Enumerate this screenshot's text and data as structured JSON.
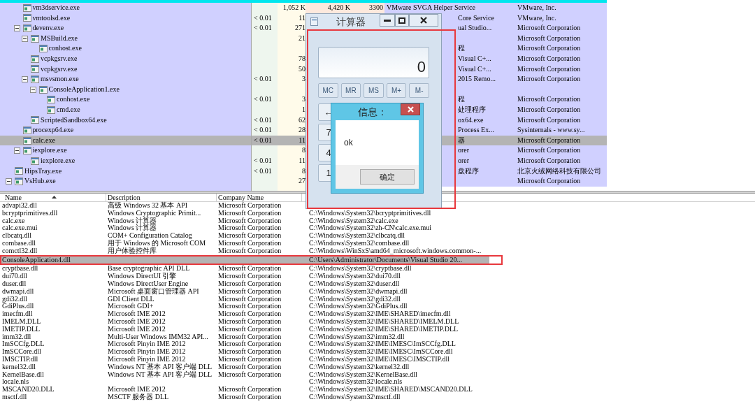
{
  "process_tree": [
    {
      "children": [
        {
          "name": "vm3dservice.exe",
          "private_bytes": "1,052 K",
          "working_set": "4,420 K",
          "pid": "3300",
          "description": "VMware SVGA Helper Service",
          "company": "VMware, Inc.",
          "selected": false
        },
        {
          "name": "vmtoolsd.exe",
          "cpu": "< 0.01",
          "private_bytes": "11",
          "description_cut": "Core Service",
          "company": "VMware, Inc.",
          "selected": false
        },
        {
          "name": "devenv.exe",
          "cpu": "< 0.01",
          "private_bytes": "271",
          "description_cut": "ual Studio...",
          "company": "Microsoft Corporation",
          "selected": false,
          "expanded": true,
          "children": [
            {
              "name": "MSBuild.exe",
              "private_bytes": "21",
              "company": "Microsoft Corporation",
              "selected": false,
              "expanded": true,
              "children": [
                {
                  "name": "conhost.exe",
                  "description_cut": "程",
                  "company": "Microsoft Corporation",
                  "selected": false
                }
              ]
            },
            {
              "name": "vcpkgsrv.exe",
              "private_bytes": "78",
              "description_cut": "Visual C+...",
              "company": "Microsoft Corporation",
              "selected": false
            },
            {
              "name": "vcpkgsrv.exe",
              "private_bytes": "50",
              "description_cut": "Visual C+...",
              "company": "Microsoft Corporation",
              "selected": false
            },
            {
              "name": "msvsmon.exe",
              "cpu": "< 0.01",
              "private_bytes": "3",
              "description_cut": "2015 Remo...",
              "company": "Microsoft Corporation",
              "selected": false,
              "expanded": true,
              "children": [
                {
                  "name": "ConsoleApplication1.exe",
                  "selected": false,
                  "expanded": true,
                  "children": [
                    {
                      "name": "conhost.exe",
                      "cpu": "< 0.01",
                      "private_bytes": "3",
                      "description_cut": "程",
                      "company": "Microsoft Corporation",
                      "selected": false
                    },
                    {
                      "name": "cmd.exe",
                      "private_bytes": "1",
                      "description_cut": "处理程序",
                      "company": "Microsoft Corporation",
                      "selected": false
                    }
                  ]
                }
              ]
            },
            {
              "name": "ScriptedSandbox64.exe",
              "cpu": "< 0.01",
              "private_bytes": "62",
              "description_cut": "ox64.exe",
              "company": "Microsoft Corporation",
              "selected": false
            }
          ]
        },
        {
          "name": "procexp64.exe",
          "cpu": "< 0.01",
          "private_bytes": "28",
          "description_cut": "Process Ex...",
          "company": "Sysinternals - www.sy...",
          "selected": false
        },
        {
          "name": "calc.exe",
          "cpu": "< 0.01",
          "private_bytes": "11",
          "description_cut": "器",
          "company": "Microsoft Corporation",
          "selected": true
        },
        {
          "name": "iexplore.exe",
          "private_bytes": "8",
          "description_cut": "orer",
          "company": "Microsoft Corporation",
          "selected": false,
          "expanded": true,
          "children": [
            {
              "name": "iexplore.exe",
              "cpu": "< 0.01",
              "private_bytes": "11",
              "description_cut": "orer",
              "company": "Microsoft Corporation",
              "selected": false
            }
          ]
        }
      ]
    },
    {
      "name": "HipsTray.exe",
      "cpu": "< 0.01",
      "private_bytes": "8",
      "description_cut": "盘程序",
      "company": "北京火绒网络科技有限公司",
      "selected": false
    },
    {
      "name": "VsHub.exe",
      "private_bytes": "27",
      "company": "Microsoft Corporation",
      "selected": false,
      "expanded": true
    }
  ],
  "dll_table": {
    "columns": [
      "Name",
      "Description",
      "Company Name"
    ],
    "sort_ascending": true,
    "rows": [
      {
        "name": "advapi32.dll",
        "description": "高级 Windows 32 基本 API",
        "company": "Microsoft Corporation",
        "selected": false
      },
      {
        "name": "bcryptprimitives.dll",
        "description": "Windows Cryptographic Primit...",
        "company": "Microsoft Corporation",
        "path": "C:\\Windows\\System32\\bcryptprimitives.dll",
        "selected": false
      },
      {
        "name": "calc.exe",
        "description": "Windows 计算器",
        "company": "Microsoft Corporation",
        "path": "C:\\Windows\\System32\\calc.exe",
        "selected": false
      },
      {
        "name": "calc.exe.mui",
        "description": "Windows 计算器",
        "company": "Microsoft Corporation",
        "path": "C:\\Windows\\System32\\zh-CN\\calc.exe.mui",
        "selected": false
      },
      {
        "name": "clbcatq.dll",
        "description": "COM+ Configuration Catalog",
        "company": "Microsoft Corporation",
        "path": "C:\\Windows\\System32\\clbcatq.dll",
        "selected": false
      },
      {
        "name": "combase.dll",
        "description": "用于 Windows 的 Microsoft COM",
        "company": "Microsoft Corporation",
        "path": "C:\\Windows\\System32\\combase.dll",
        "selected": false
      },
      {
        "name": "comctl32.dll",
        "description": "用户体验控件库",
        "company": "Microsoft Corporation",
        "path": "C:\\Windows\\WinSxS\\amd64_microsoft.windows.common-...",
        "selected": false
      },
      {
        "name": "ConsoleApplication4.dll",
        "path": "C:\\Users\\Administrator\\Documents\\Visual Studio 20...",
        "selected": true
      },
      {
        "name": "cryptbase.dll",
        "description": "Base cryptographic API DLL",
        "company": "Microsoft Corporation",
        "path": "C:\\Windows\\System32\\cryptbase.dll",
        "selected": false
      },
      {
        "name": "dui70.dll",
        "description": "Windows DirectUI 引擎",
        "company": "Microsoft Corporation",
        "path": "C:\\Windows\\System32\\dui70.dll",
        "selected": false
      },
      {
        "name": "duser.dll",
        "description": "Windows DirectUser Engine",
        "company": "Microsoft Corporation",
        "path": "C:\\Windows\\System32\\duser.dll",
        "selected": false
      },
      {
        "name": "dwmapi.dll",
        "description": "Microsoft 桌面窗口管理器 API",
        "company": "Microsoft Corporation",
        "path": "C:\\Windows\\System32\\dwmapi.dll",
        "selected": false
      },
      {
        "name": "gdi32.dll",
        "description": "GDI Client DLL",
        "company": "Microsoft Corporation",
        "path": "C:\\Windows\\System32\\gdi32.dll",
        "selected": false
      },
      {
        "name": "GdiPlus.dll",
        "description": "Microsoft GDI+",
        "company": "Microsoft Corporation",
        "path": "C:\\Windows\\System32\\GdiPlus.dll",
        "selected": false
      },
      {
        "name": "imecfm.dll",
        "description": "Microsoft IME 2012",
        "company": "Microsoft Corporation",
        "path": "C:\\Windows\\System32\\IME\\SHARED\\imecfm.dll",
        "selected": false
      },
      {
        "name": "IMELM.DLL",
        "description": "Microsoft IME 2012",
        "company": "Microsoft Corporation",
        "path": "C:\\Windows\\System32\\IME\\SHARED\\IMELM.DLL",
        "selected": false
      },
      {
        "name": "IMETIP.DLL",
        "description": "Microsoft IME 2012",
        "company": "Microsoft Corporation",
        "path": "C:\\Windows\\System32\\IME\\SHARED\\IMETIP.DLL",
        "selected": false
      },
      {
        "name": "imm32.dll",
        "description": "Multi-User Windows IMM32 API...",
        "company": "Microsoft Corporation",
        "path": "C:\\Windows\\System32\\imm32.dll",
        "selected": false
      },
      {
        "name": "ImSCCfg.DLL",
        "description": "Microsoft Pinyin IME 2012",
        "company": "Microsoft Corporation",
        "path": "C:\\Windows\\System32\\IME\\IMESC\\ImSCCfg.DLL",
        "selected": false
      },
      {
        "name": "ImSCCore.dll",
        "description": "Microsoft Pinyin IME 2012",
        "company": "Microsoft Corporation",
        "path": "C:\\Windows\\System32\\IME\\IMESC\\ImSCCore.dll",
        "selected": false
      },
      {
        "name": "IMSCTIP.dll",
        "description": "Microsoft Pinyin IME 2012",
        "company": "Microsoft Corporation",
        "path": "C:\\Windows\\System32\\IME\\IMESC\\IMSCTIP.dll",
        "selected": false
      },
      {
        "name": "kernel32.dll",
        "description": "Windows NT 基本 API 客户端 DLL",
        "company": "Microsoft Corporation",
        "path": "C:\\Windows\\System32\\kernel32.dll",
        "selected": false
      },
      {
        "name": "KernelBase.dll",
        "description": "Windows NT 基本 API 客户端 DLL",
        "company": "Microsoft Corporation",
        "path": "C:\\Windows\\System32\\KernelBase.dll",
        "selected": false
      },
      {
        "name": "locale.nls",
        "path": "C:\\Windows\\System32\\locale.nls",
        "selected": false
      },
      {
        "name": "MSCAND20.DLL",
        "description": "Microsoft IME 2012",
        "company": "Microsoft Corporation",
        "path": "C:\\Windows\\System32\\IME\\SHARED\\MSCAND20.DLL",
        "selected": false
      },
      {
        "name": "msctf.dll",
        "description": "MSCTF 服务器 DLL",
        "company": "Microsoft Corporation",
        "path": "C:\\Windows\\System32\\msctf.dll",
        "selected": false
      }
    ]
  },
  "calculator": {
    "title": "计算器",
    "display": "0",
    "memory_keys": [
      "MC",
      "MR",
      "MS",
      "M+",
      "M-"
    ],
    "keys": [
      "←",
      "7",
      "4",
      "1"
    ]
  },
  "message_box": {
    "title": "信息：",
    "message": "ok",
    "button": "确定"
  }
}
